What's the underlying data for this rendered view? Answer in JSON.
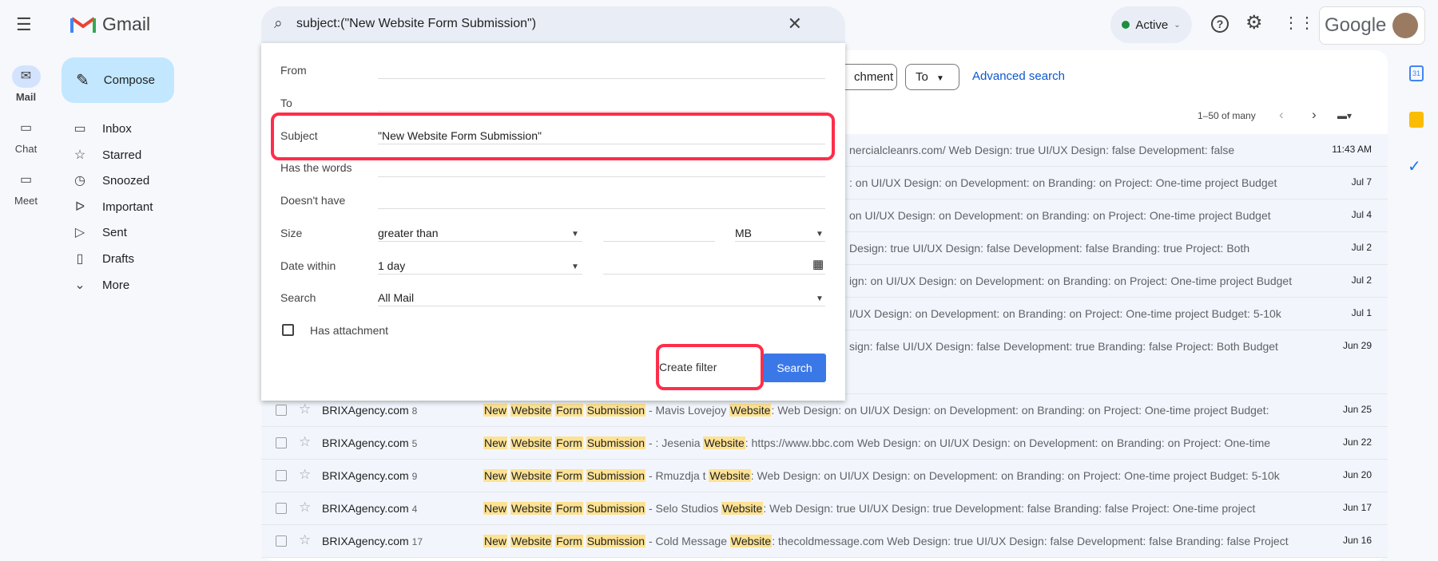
{
  "app": {
    "name": "Gmail"
  },
  "rail": [
    {
      "label": "Mail",
      "icon": "mail-icon"
    },
    {
      "label": "Chat",
      "icon": "chat-icon"
    },
    {
      "label": "Meet",
      "icon": "video-icon"
    }
  ],
  "compose": "Compose",
  "nav": [
    {
      "label": "Inbox",
      "icon": "inbox-icon"
    },
    {
      "label": "Starred",
      "icon": "star-icon"
    },
    {
      "label": "Snoozed",
      "icon": "clock-icon"
    },
    {
      "label": "Important",
      "icon": "important-icon"
    },
    {
      "label": "Sent",
      "icon": "send-icon"
    },
    {
      "label": "Drafts",
      "icon": "draft-icon"
    },
    {
      "label": "More",
      "icon": "chevron-down-icon"
    }
  ],
  "search": {
    "value": "subject:(\"New Website Form Submission\")"
  },
  "header": {
    "status": "Active",
    "brand": "Google"
  },
  "chips": {
    "attachment": "chment",
    "to": "To",
    "advanced": "Advanced search"
  },
  "pagination": {
    "range": "1–50 of many"
  },
  "filter": {
    "from_label": "From",
    "to_label": "To",
    "subject_label": "Subject",
    "subject_value": "\"New Website Form Submission\"",
    "has_words_label": "Has the words",
    "doesnt_have_label": "Doesn't have",
    "size_label": "Size",
    "size_op": "greater than",
    "size_unit": "MB",
    "date_label": "Date within",
    "date_value": "1 day",
    "search_label": "Search",
    "search_value": "All Mail",
    "attachment_label": "Has attachment",
    "create_filter": "Create filter",
    "search_button": "Search"
  },
  "hidden_rows": [
    {
      "frag": "nercialcleanrs.com/ Web Design: true UI/UX Design: false Development: false",
      "date": "11:43 AM"
    },
    {
      "frag": ": on UI/UX Design: on Development: on Branding: on Project: One-time project Budget",
      "date": "Jul 7"
    },
    {
      "frag": "on UI/UX Design: on Development: on Branding: on Project: One-time project Budget",
      "date": "Jul 4"
    },
    {
      "frag": "Design: true UI/UX Design: false Development: false Branding: true Project: Both",
      "date": "Jul 2"
    },
    {
      "frag": "ign: on UI/UX Design: on Development: on Branding: on Project: One-time project Budget",
      "date": "Jul 2"
    },
    {
      "frag": "I/UX Design: on Development: on Branding: on Project: One-time project Budget: 5-10k",
      "date": "Jul 1"
    },
    {
      "frag": "sign: false UI/UX Design: false Development: true Branding: false Project: Both Budget",
      "date": "Jun 29"
    }
  ],
  "rows": [
    {
      "sender": "BRIXAgency.com",
      "count": "8",
      "w1": "New",
      "w2": "Website",
      "w3": "Form",
      "w4": "Submission",
      "pre": " - Mavis Lovejoy ",
      "hw": "Website",
      "post": ": Web Design: on UI/UX Design: on Development: on Branding: on Project: One-time project Budget:",
      "date": "Jun 25"
    },
    {
      "sender": "BRIXAgency.com",
      "count": "5",
      "w1": "New",
      "w2": "Website",
      "w3": "Form",
      "w4": "Submission",
      "pre": " - : Jesenia ",
      "hw": "Website",
      "post": ": https://www.bbc.com Web Design: on UI/UX Design: on Development: on Branding: on Project: One-time",
      "date": "Jun 22"
    },
    {
      "sender": "BRIXAgency.com",
      "count": "9",
      "w1": "New",
      "w2": "Website",
      "w3": "Form",
      "w4": "Submission",
      "pre": " - Rmuzdja t ",
      "hw": "Website",
      "post": ": Web Design: on UI/UX Design: on Development: on Branding: on Project: One-time project Budget: 5-10k",
      "date": "Jun 20"
    },
    {
      "sender": "BRIXAgency.com",
      "count": "4",
      "w1": "New",
      "w2": "Website",
      "w3": "Form",
      "w4": "Submission",
      "pre": " - Selo Studios ",
      "hw": "Website",
      "post": ": Web Design: true UI/UX Design: true Development: false Branding: false Project: One-time project",
      "date": "Jun 17"
    },
    {
      "sender": "BRIXAgency.com",
      "count": "17",
      "w1": "New",
      "w2": "Website",
      "w3": "Form",
      "w4": "Submission",
      "pre": " - Cold Message ",
      "hw": "Website",
      "post": ": thecoldmessage.com Web Design: true UI/UX Design: false Development: false Branding: false Project",
      "date": "Jun 16"
    }
  ],
  "colors": {
    "accent": "#0b57d0",
    "search_btn": "#3b78e7",
    "highlight": "#fde293",
    "annotation": "#ff2d4a"
  }
}
